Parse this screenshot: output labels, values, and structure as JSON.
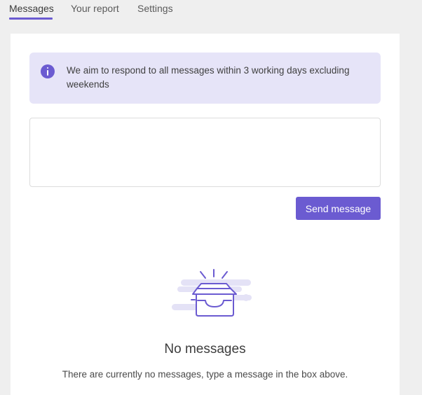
{
  "tabs": [
    {
      "label": "Messages",
      "active": true
    },
    {
      "label": "Your report",
      "active": false
    },
    {
      "label": "Settings",
      "active": false
    }
  ],
  "info": {
    "icon": "info-icon",
    "text": "We aim to respond to all messages within 3 working days excluding weekends"
  },
  "composer": {
    "value": "",
    "send_label": "Send message"
  },
  "empty_state": {
    "icon": "empty-inbox-icon",
    "title": "No messages",
    "subtitle": "There are currently no messages, type a message in the box above."
  },
  "colors": {
    "accent": "#6b5bd1",
    "info_background": "#e6e4f8",
    "page_background": "#efefef",
    "illustration_light": "#e4e2f6"
  }
}
